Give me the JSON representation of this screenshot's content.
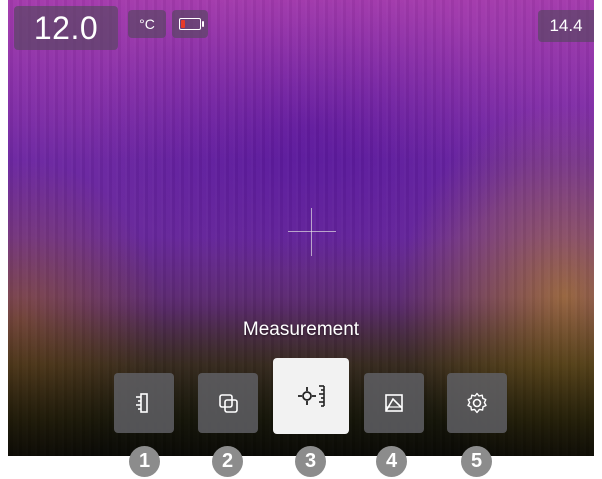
{
  "status": {
    "temperature": "12.0",
    "unit": "°C",
    "max_temperature": "14.4",
    "battery_level": 0.2
  },
  "menu": {
    "title": "Measurement",
    "selected_index": 3,
    "items": [
      {
        "icon": "ruler-icon",
        "number": "1"
      },
      {
        "icon": "image-overlay-icon",
        "number": "2"
      },
      {
        "icon": "spot-measure-icon",
        "number": "3"
      },
      {
        "icon": "color-palette-icon",
        "number": "4"
      },
      {
        "icon": "settings-gear-icon",
        "number": "5"
      }
    ]
  },
  "colors": {
    "selected_button": "#f2f2f2",
    "button": "#5f5f64",
    "number_badge": "#8c8c8c",
    "battery_low": "#e83a2a"
  }
}
